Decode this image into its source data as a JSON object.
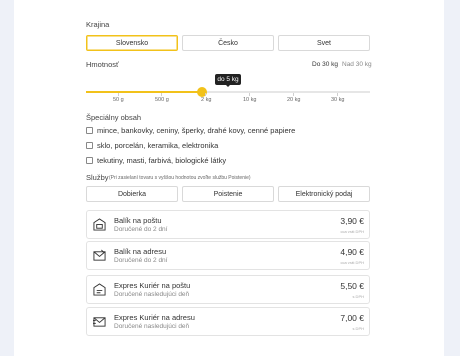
{
  "country": {
    "label": "Krajina",
    "options": [
      "Slovensko",
      "Česko",
      "Svet"
    ],
    "selected": "Slovensko"
  },
  "weight": {
    "label": "Hmotnosť",
    "range_text_1": "Do 30 kg",
    "range_text_2": "Nad 30 kg",
    "tooltip": "do 5 kg",
    "ticks": [
      "50 g",
      "500 g",
      "2 kg",
      "10 kg",
      "20 kg",
      "30 kg"
    ],
    "slider_value_fraction": 0.41
  },
  "special": {
    "label": "Špeciálny obsah",
    "items": [
      "mince, bankovky, ceniny, šperky, drahé kovy, cenné papiere",
      "sklo, porcelán, keramika, elektronika",
      "tekutiny, masti, farbivá, biologické látky"
    ]
  },
  "services": {
    "label": "Služby",
    "note": "(Pri zasielaní tovaru s vyššou hodnotou zvoľte službu Poistenie)",
    "buttons": [
      "Dobierka",
      "Poistenie",
      "Elektronický podaj"
    ]
  },
  "shipping": [
    {
      "title": "Balík na poštu",
      "subtitle": "Doručené do 2 dní",
      "price": "3,90 €",
      "note": "cca vrát DPH",
      "icon": "parcel-post-icon"
    },
    {
      "title": "Balík na adresu",
      "subtitle": "Doručené do 2 dní",
      "price": "4,90 €",
      "note": "cca vrát DPH",
      "icon": "parcel-address-icon"
    },
    {
      "title": "Expres Kuriér na poštu",
      "subtitle": "Doručené nasledujúci deň",
      "price": "5,50 €",
      "note": "s DPH",
      "icon": "express-post-icon"
    },
    {
      "title": "Expres Kuriér na adresu",
      "subtitle": "Doručené nasledujúci deň",
      "price": "7,00 €",
      "note": "s DPH",
      "icon": "express-address-icon"
    }
  ],
  "colors": {
    "accent": "#f2c21a",
    "background": "#eef1f8"
  }
}
